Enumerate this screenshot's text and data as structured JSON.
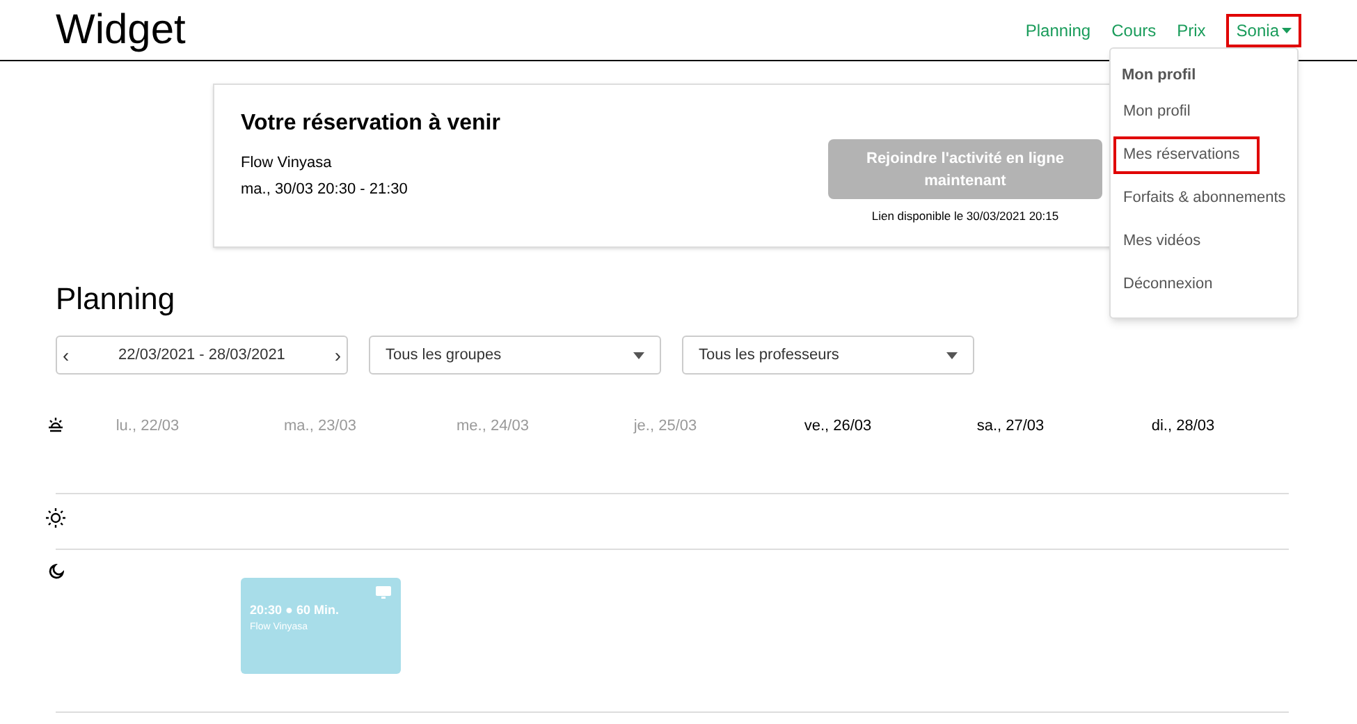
{
  "brand": "Widget",
  "nav": [
    {
      "label": "Planning",
      "highlighted": false
    },
    {
      "label": "Cours",
      "highlighted": false
    },
    {
      "label": "Prix",
      "highlighted": false
    }
  ],
  "user_menu": {
    "label": "Sonia",
    "highlighted": true,
    "header": "Mon profil",
    "items": [
      {
        "label": "Mon profil",
        "highlighted": false
      },
      {
        "label": "Mes réservations",
        "highlighted": true
      },
      {
        "label": "Forfaits & abonnements",
        "highlighted": false
      },
      {
        "label": "Mes vidéos",
        "highlighted": false
      },
      {
        "label": "Déconnexion",
        "highlighted": false
      }
    ]
  },
  "booking": {
    "title": "Votre réservation à venir",
    "class": "Flow Vinyasa",
    "when": "ma., 30/03 20:30 - 21:30",
    "join_button": {
      "label": "Rejoindre l'activité en ligne maintenant",
      "disabled": true
    },
    "note": "Lien disponible le 30/03/2021 20:15"
  },
  "planning": {
    "title": "Planning",
    "prev": "‹",
    "range": "22/03/2021 - 28/03/2021",
    "next": "›",
    "groups": "Tous les groupes",
    "teachers": "Tous les professeurs",
    "days": [
      {
        "label": "lu., 22/03",
        "past": true
      },
      {
        "label": "ma., 23/03",
        "past": true,
        "events": [
          {
            "kind": "evening",
            "time": "20:30 ● 60 Min.",
            "name": "Flow Vinyasa",
            "online": true
          }
        ]
      },
      {
        "label": "me., 24/03",
        "past": true
      },
      {
        "label": "je., 25/03",
        "past": true
      },
      {
        "label": "ve., 26/03",
        "past": false
      },
      {
        "label": "sa., 27/03",
        "past": false
      },
      {
        "label": "di., 28/03",
        "past": false
      }
    ],
    "periods": [
      {
        "kind": "morning"
      },
      {
        "kind": "afternoon"
      },
      {
        "kind": "evening"
      }
    ]
  }
}
